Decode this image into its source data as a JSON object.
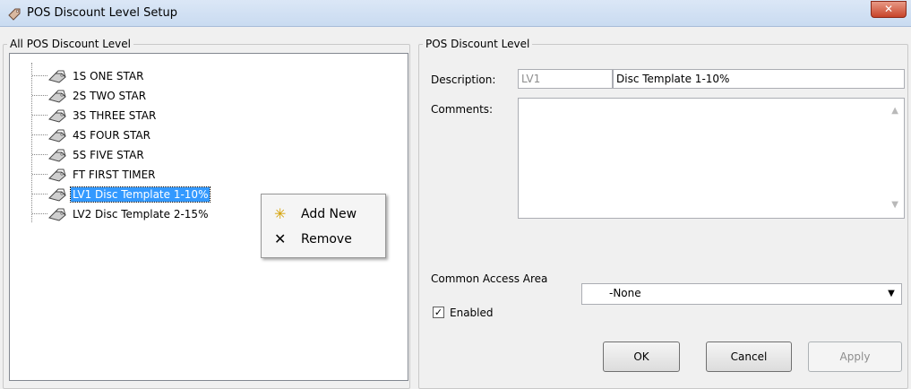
{
  "window": {
    "title": "POS Discount Level Setup",
    "close_label": "✕"
  },
  "left_panel": {
    "legend": "All POS Discount Level",
    "tree_items": [
      {
        "code": "1S",
        "name": "ONE STAR",
        "label": "1S  ONE STAR"
      },
      {
        "code": "2S",
        "name": "TWO STAR",
        "label": "2S  TWO STAR"
      },
      {
        "code": "3S",
        "name": "THREE STAR",
        "label": "3S  THREE STAR"
      },
      {
        "code": "4S",
        "name": "FOUR STAR",
        "label": "4S  FOUR STAR"
      },
      {
        "code": "5S",
        "name": "FIVE STAR",
        "label": "5S  FIVE STAR"
      },
      {
        "code": "FT",
        "name": "FIRST TIMER",
        "label": "FT  FIRST TIMER"
      },
      {
        "code": "LV1",
        "name": "Disc Template 1-10%",
        "label": "LV1  Disc Template 1-10%",
        "selected": true
      },
      {
        "code": "LV2",
        "name": "Disc Template 2-15%",
        "label": "LV2  Disc Template 2-15%"
      }
    ],
    "context_menu": {
      "items": [
        {
          "label": "Add New",
          "icon": "star-burst-icon"
        },
        {
          "label": "Remove",
          "icon": "x-icon"
        }
      ]
    }
  },
  "right_panel": {
    "legend": "POS Discount Level",
    "description_label": "Description:",
    "code_value": "LV1",
    "description_value": "Disc Template 1-10%",
    "comments_label": "Comments:",
    "comments_value": "",
    "access_area_label": "Common Access Area",
    "access_area_value": "-None",
    "enabled_label": "Enabled",
    "enabled_checked": true,
    "buttons": {
      "ok": "OK",
      "cancel": "Cancel",
      "apply": "Apply"
    }
  },
  "colors": {
    "selection": "#3399ff",
    "close_button": "#c7432a"
  }
}
